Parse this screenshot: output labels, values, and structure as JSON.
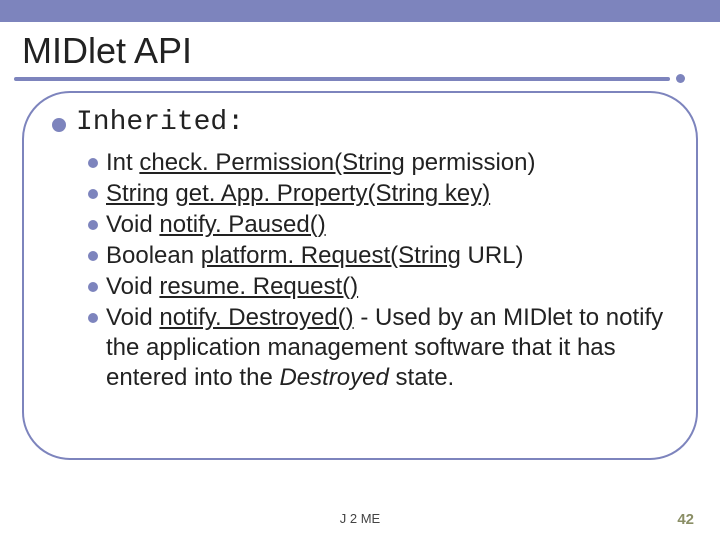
{
  "slide": {
    "title": "MIDlet API",
    "section": "Inherited:",
    "items": [
      {
        "prefix": "Int ",
        "link": "check. Permission(String",
        "suffix": " permission)"
      },
      {
        "prefix": "",
        "link": "String",
        "suffix": " ",
        "link2": "get. App. Property(String key)"
      },
      {
        "prefix": "Void ",
        "link": "notify. Paused()",
        "suffix": ""
      },
      {
        "prefix": "Boolean ",
        "link": "platform. Request(String",
        "suffix": " URL)"
      },
      {
        "prefix": "Void ",
        "link": "resume. Request()",
        "suffix": ""
      },
      {
        "prefix": "Void ",
        "link": "notify. Destroyed()",
        "suffix": " -  Used by an MIDlet to notify the application management software that it has entered into the ",
        "italic": "Destroyed",
        "tail": " state."
      }
    ],
    "footer": "J 2 ME",
    "page": "42"
  }
}
